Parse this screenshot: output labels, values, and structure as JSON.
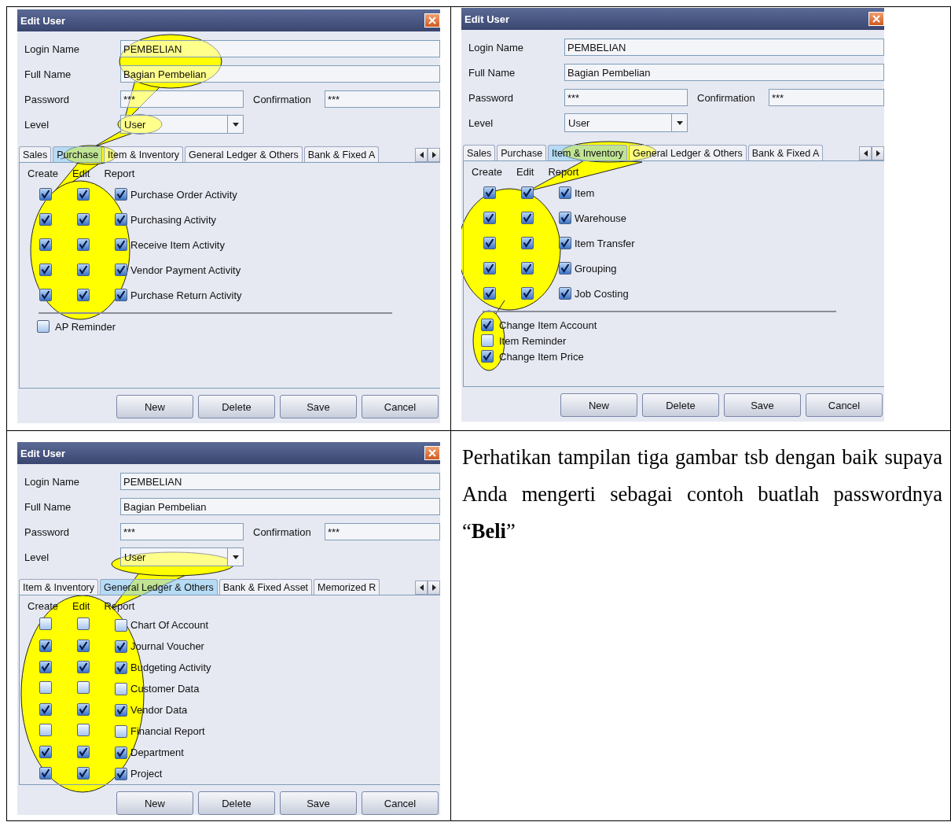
{
  "windows": [
    {
      "title": "Edit User",
      "login_name": {
        "label": "Login Name",
        "value": "PEMBELIAN"
      },
      "full_name": {
        "label": "Full Name",
        "value": "Bagian Pembelian"
      },
      "password": {
        "label": "Password",
        "value": "***"
      },
      "confirmation": {
        "label": "Confirmation",
        "value": "***"
      },
      "level": {
        "label": "Level",
        "value": "User"
      },
      "tabs": [
        {
          "label": "Sales",
          "selected": false
        },
        {
          "label": "Purchase",
          "selected": true
        },
        {
          "label": "Item & Inventory",
          "selected": false
        },
        {
          "label": "General Ledger & Others",
          "selected": false
        },
        {
          "label": "Bank & Fixed A",
          "selected": false
        }
      ],
      "columns": [
        "Create",
        "Edit",
        "Report"
      ],
      "rows": [
        {
          "label": "Purchase Order Activity",
          "create": true,
          "edit": true,
          "report": true
        },
        {
          "label": "Purchasing Activity",
          "create": true,
          "edit": true,
          "report": true
        },
        {
          "label": "Receive Item Activity",
          "create": true,
          "edit": true,
          "report": true
        },
        {
          "label": "Vendor Payment Activity",
          "create": true,
          "edit": true,
          "report": true
        },
        {
          "label": "Purchase Return Activity",
          "create": true,
          "edit": true,
          "report": true
        }
      ],
      "extras": [
        {
          "label": "AP Reminder",
          "checked": false
        }
      ],
      "buttons": [
        "New",
        "Delete",
        "Save",
        "Cancel"
      ]
    },
    {
      "title": "Edit User",
      "login_name": {
        "label": "Login Name",
        "value": "PEMBELIAN"
      },
      "full_name": {
        "label": "Full Name",
        "value": "Bagian Pembelian"
      },
      "password": {
        "label": "Password",
        "value": "***"
      },
      "confirmation": {
        "label": "Confirmation",
        "value": "***"
      },
      "level": {
        "label": "Level",
        "value": "User"
      },
      "tabs": [
        {
          "label": "Sales",
          "selected": false
        },
        {
          "label": "Purchase",
          "selected": false
        },
        {
          "label": "Item & Inventory",
          "selected": true
        },
        {
          "label": "General Ledger & Others",
          "selected": false
        },
        {
          "label": "Bank & Fixed A",
          "selected": false
        }
      ],
      "columns": [
        "Create",
        "Edit",
        "Report"
      ],
      "rows": [
        {
          "label": "Item",
          "create": true,
          "edit": true,
          "report": true
        },
        {
          "label": "Warehouse",
          "create": true,
          "edit": true,
          "report": true
        },
        {
          "label": "Item Transfer",
          "create": true,
          "edit": true,
          "report": true
        },
        {
          "label": "Grouping",
          "create": true,
          "edit": true,
          "report": true
        },
        {
          "label": "Job Costing",
          "create": true,
          "edit": true,
          "report": true
        }
      ],
      "extras": [
        {
          "label": "Change Item Account",
          "checked": true
        },
        {
          "label": "Item Reminder",
          "checked": false
        },
        {
          "label": "Change Item Price",
          "checked": true
        }
      ],
      "buttons": [
        "New",
        "Delete",
        "Save",
        "Cancel"
      ]
    },
    {
      "title": "Edit User",
      "login_name": {
        "label": "Login Name",
        "value": "PEMBELIAN"
      },
      "full_name": {
        "label": "Full Name",
        "value": "Bagian Pembelian"
      },
      "password": {
        "label": "Password",
        "value": "***"
      },
      "confirmation": {
        "label": "Confirmation",
        "value": "***"
      },
      "level": {
        "label": "Level",
        "value": "User"
      },
      "tabs": [
        {
          "label": "Item & Inventory",
          "selected": false
        },
        {
          "label": "General Ledger & Others",
          "selected": true
        },
        {
          "label": "Bank & Fixed Asset",
          "selected": false
        },
        {
          "label": "Memorized R",
          "selected": false
        }
      ],
      "columns": [
        "Create",
        "Edit",
        "Report"
      ],
      "rows": [
        {
          "label": "Chart Of Account",
          "create": false,
          "edit": false,
          "report": false
        },
        {
          "label": "Journal Voucher",
          "create": true,
          "edit": true,
          "report": true
        },
        {
          "label": "Budgeting Activity",
          "create": true,
          "edit": true,
          "report": true
        },
        {
          "label": "Customer Data",
          "create": false,
          "edit": false,
          "report": false
        },
        {
          "label": "Vendor Data",
          "create": true,
          "edit": true,
          "report": true
        },
        {
          "label": "Financial Report",
          "create": false,
          "edit": false,
          "report": false
        },
        {
          "label": "Department",
          "create": true,
          "edit": true,
          "report": true
        },
        {
          "label": "Project",
          "create": true,
          "edit": true,
          "report": true
        }
      ],
      "buttons": [
        "New",
        "Delete",
        "Save",
        "Cancel"
      ]
    }
  ],
  "note": "Perhatikan tampilan tiga gambar tsb dengan baik supaya Anda mengerti sebagai contoh buatlah passwordnya “**Beli**”"
}
